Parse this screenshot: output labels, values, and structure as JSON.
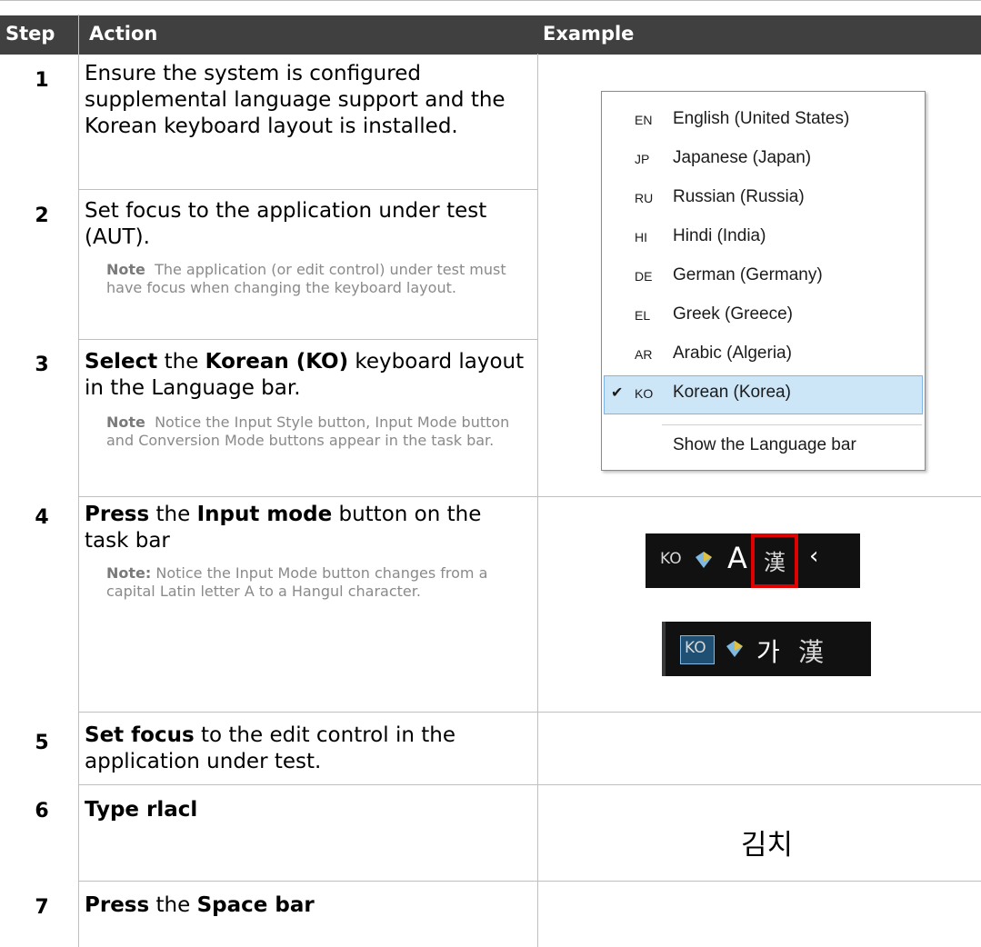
{
  "table": {
    "headers": [
      "Step",
      "Action",
      "Example"
    ],
    "rows": [
      {
        "step": "1",
        "action": "Ensure the system is configured supplemental language support and the Korean keyboard layout is installed."
      },
      {
        "step": "2",
        "action": "Set focus to the application under test (AUT).",
        "note_label": "Note",
        "note_text": "The application (or edit control) under test must have focus when changing the keyboard layout."
      },
      {
        "step": "3",
        "action_parts": [
          "Select",
          " the ",
          "Korean (KO)",
          " keyboard layout in the Language bar."
        ],
        "note_label": "Note",
        "note_text": "Notice the Input Style button, Input Mode button and Conversion Mode buttons appear in the task bar."
      },
      {
        "step": "4",
        "action_parts": [
          "Press",
          " the ",
          "Input mode",
          " button on the task bar"
        ],
        "note_label": "Note:",
        "note_text": "Notice the Input Mode button changes from a capital Latin letter A to a Hangul character."
      },
      {
        "step": "5",
        "action_parts": [
          "Set focus",
          " to the edit control in the application under test."
        ]
      },
      {
        "step": "6",
        "action": "Type rlacl"
      },
      {
        "step": "7",
        "action_parts": [
          "Press",
          " the ",
          "Space bar"
        ]
      }
    ]
  },
  "language_menu": {
    "items": [
      {
        "code": "EN",
        "label": "English (United States)"
      },
      {
        "code": "JP",
        "label": "Japanese (Japan)"
      },
      {
        "code": "RU",
        "label": "Russian (Russia)"
      },
      {
        "code": "HI",
        "label": "Hindi (India)"
      },
      {
        "code": "DE",
        "label": "German (Germany)"
      },
      {
        "code": "EL",
        "label": "Greek (Greece)"
      },
      {
        "code": "AR",
        "label": "Arabic (Algeria)"
      },
      {
        "code": "KO",
        "label": "Korean (Korea)",
        "selected": true
      }
    ],
    "footer": "Show the Language bar",
    "checkmark": "✔"
  },
  "taskbar_before": {
    "code": "KO",
    "mode": "A",
    "hanja": "漢",
    "arrow": "‹"
  },
  "taskbar_after": {
    "code": "KO",
    "mode": "가",
    "hanja": "漢"
  },
  "example_text_step6": "김치",
  "colors": {
    "header_bg": "#404040",
    "highlight": "#e00000",
    "selection_bg": "#cde6f7"
  }
}
